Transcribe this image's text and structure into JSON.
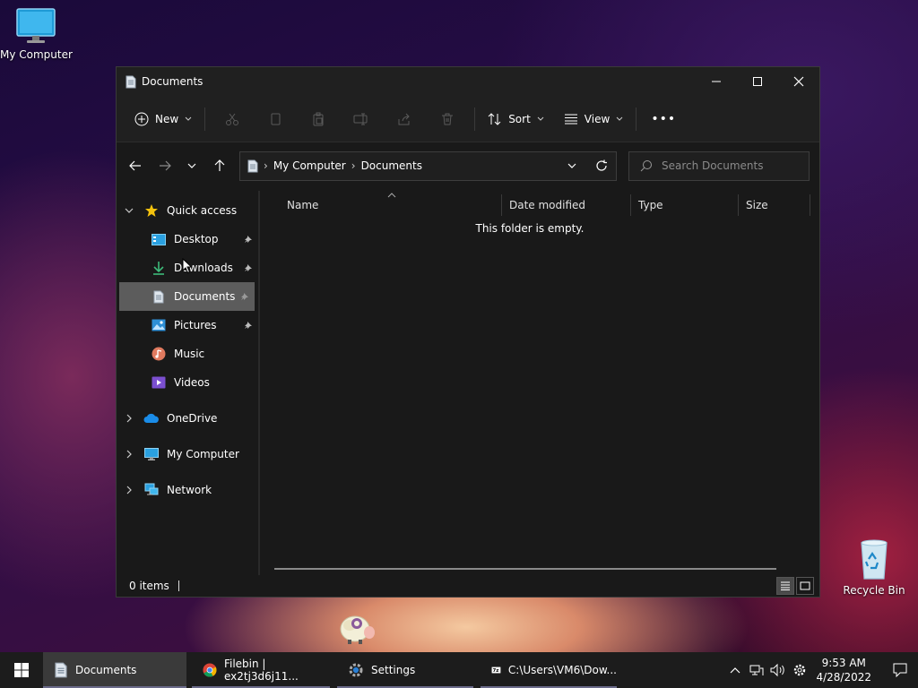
{
  "desktop": {
    "my_computer_label": "My Computer",
    "recycle_bin_label": "Recycle Bin"
  },
  "window": {
    "title": "Documents",
    "toolbar": {
      "new_label": "New",
      "sort_label": "Sort",
      "view_label": "View",
      "more_label": "•••"
    },
    "address": {
      "crumbs": [
        "My Computer",
        "Documents"
      ],
      "separator": "›"
    },
    "search": {
      "placeholder": "Search Documents"
    },
    "nav": {
      "quick_access": "Quick access",
      "items": [
        {
          "label": "Desktop",
          "pinned": true
        },
        {
          "label": "Downloads",
          "pinned": true
        },
        {
          "label": "Documents",
          "pinned": true,
          "selected": true
        },
        {
          "label": "Pictures",
          "pinned": true
        },
        {
          "label": "Music",
          "pinned": false
        },
        {
          "label": "Videos",
          "pinned": false
        }
      ],
      "onedrive": "OneDrive",
      "my_computer": "My Computer",
      "network": "Network"
    },
    "columns": [
      "Name",
      "Date modified",
      "Type",
      "Size"
    ],
    "empty_message": "This folder is empty.",
    "status": {
      "items": "0 items"
    }
  },
  "taskbar": {
    "apps": [
      {
        "label": "Documents",
        "active": true
      },
      {
        "label": "Filebin | ex2tj3d6j11...",
        "active": false
      },
      {
        "label": "Settings",
        "active": false
      },
      {
        "label": "C:\\Users\\VM6\\Dow...",
        "active": false
      }
    ],
    "time": "9:53 AM",
    "date": "4/28/2022"
  },
  "colors": {
    "accent": "#0078d4",
    "selected_nav": "#5c5c5c",
    "window_bg": "#191919",
    "taskbar_bg": "#1c1c1c"
  }
}
